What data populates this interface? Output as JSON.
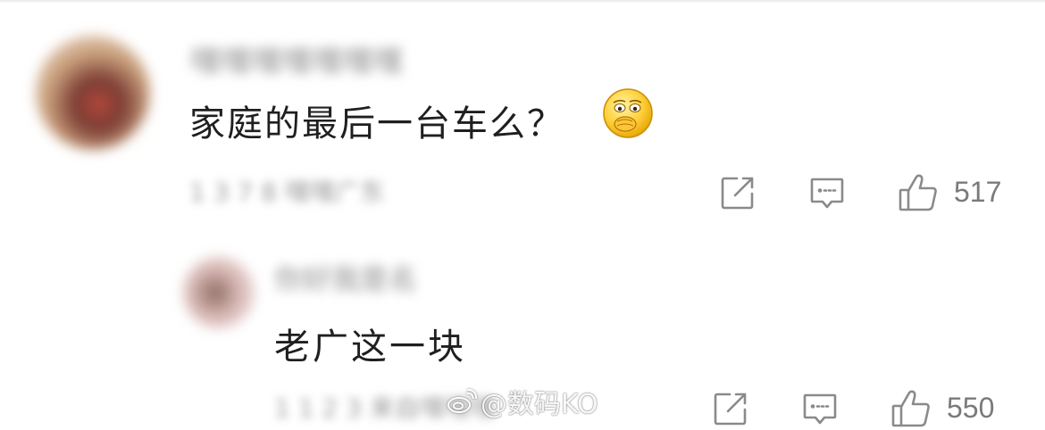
{
  "comments": [
    {
      "text": "家庭的最后一台车么？",
      "username": "嘿嘿嘿嘿嘿嘿嘿",
      "meta": "1  3  7  8  嘿嘿广东",
      "likes": "517",
      "emoji": "covering-mouth-emoji"
    },
    {
      "text": "老广这一块",
      "username": "你好我是名",
      "meta": "1  1  2  3  来自嘿嘿嘿",
      "likes": "550"
    }
  ],
  "icons": {
    "share": "share-icon",
    "reply": "reply-icon",
    "like": "thumbs-up-icon",
    "watermark": "weibo-icon"
  },
  "watermark": {
    "text": "@数码KO"
  },
  "colors": {
    "text": "#1f1f1f",
    "secondary": "#9a9a9a",
    "icon": "#8a8a8a",
    "background": "#ffffff"
  }
}
